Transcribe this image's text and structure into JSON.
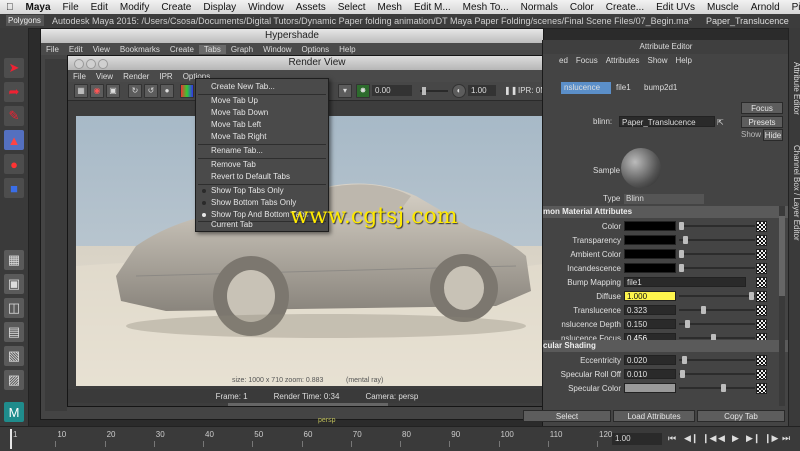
{
  "mac_menubar": {
    "app_name": "Maya",
    "items": [
      "File",
      "Edit",
      "Modify",
      "Create",
      "Display",
      "Window",
      "Assets",
      "Select",
      "Mesh",
      "Edit M...",
      "Mesh To...",
      "Normals",
      "Color",
      "Create...",
      "Edit UVs",
      "Muscle",
      "Arnold",
      "Pipeline"
    ]
  },
  "maya_window": {
    "mode": "Polygons",
    "title": "Autodesk Maya 2015: /Users/Csosa/Documents/Digital Tutors/Dynamic Paper folding animation/DT Maya Paper Folding/scenes/Final Scene Files/07_Begin.ma*",
    "title_suffix": "---",
    "title_right": "Paper_Translucence"
  },
  "hypershade": {
    "title": "Hypershade",
    "menu": [
      "File",
      "Edit",
      "View",
      "Bookmarks",
      "Create",
      "Tabs",
      "Graph",
      "Window",
      "Options",
      "Help"
    ]
  },
  "render_view": {
    "title": "Render View",
    "menu": [
      "File",
      "View",
      "Render",
      "IPR",
      "Options"
    ],
    "exposure": "0.00",
    "gamma": "1.00",
    "ipr_status": "IPR: 0MB",
    "overlay_text": "size: 1000 x 710 zoom: 0.883",
    "overlay_renderer": "(mental ray)",
    "status": {
      "frame": "Frame: 1",
      "render_time": "Render Time: 0:34",
      "camera": "Camera: persp"
    }
  },
  "tab_menu": {
    "items": [
      {
        "label": "Create New Tab..."
      },
      {
        "label": "Move Tab Up"
      },
      {
        "label": "Move Tab Down"
      },
      {
        "label": "Move Tab Left"
      },
      {
        "label": "Move Tab Right"
      },
      {
        "label": "Rename Tab..."
      },
      {
        "label": "Remove Tab"
      },
      {
        "label": "Revert to Default Tabs"
      },
      {
        "label": "Show Top Tabs Only"
      },
      {
        "label": "Show Bottom Tabs Only"
      },
      {
        "label": "Show Top And Bottom Tabs",
        "selected": true
      },
      {
        "label": "Current Tab"
      }
    ]
  },
  "attribute_editor": {
    "title": "Attribute Editor",
    "menu": [
      "ed",
      "Focus",
      "Attributes",
      "Show",
      "Help"
    ],
    "tabs": [
      "nslucence",
      "file1",
      "bump2d1"
    ],
    "type_label": "blinn:",
    "material_name": "Paper_Translucence",
    "focus_btn": "Focus",
    "presets_btn": "Presets",
    "show_btn": "Show",
    "hide_btn": "Hide",
    "sample_label": "Sample",
    "type_row_label": "Type",
    "type_value": "Blinn",
    "section_common": "mon Material Attributes",
    "section_specular": "cular Shading",
    "attrs": [
      {
        "label": "Color",
        "kind": "color",
        "color": "#000000",
        "knob": 0.0
      },
      {
        "label": "Transparency",
        "kind": "color",
        "color": "#000000",
        "knob": 0.05
      },
      {
        "label": "Ambient Color",
        "kind": "color",
        "color": "#000000",
        "knob": 0.0
      },
      {
        "label": "Incandescence",
        "kind": "color",
        "color": "#000000",
        "knob": 0.0
      },
      {
        "label": "Bump Mapping",
        "kind": "map",
        "value": "file1"
      },
      {
        "label": "Diffuse",
        "kind": "num",
        "value": "1.000",
        "highlight": true,
        "knob": 1.0
      },
      {
        "label": "Translucence",
        "kind": "num",
        "value": "0.323",
        "knob": 0.32
      },
      {
        "label": "nslucence Depth",
        "kind": "num",
        "value": "0.150",
        "knob": 0.08
      },
      {
        "label": "nslucence Focus",
        "kind": "num",
        "value": "0.456",
        "selected": true,
        "knob": 0.46
      }
    ],
    "spec_attrs": [
      {
        "label": "Eccentricity",
        "kind": "num",
        "value": "0.020",
        "knob": 0.04
      },
      {
        "label": "Specular Roll Off",
        "kind": "num",
        "value": "0.010",
        "knob": 0.02
      },
      {
        "label": "Specular Color",
        "kind": "color",
        "color": "#9a9a9a",
        "knob": 0.6
      }
    ],
    "bottom_buttons": [
      "Select",
      "Load Attributes",
      "Copy Tab"
    ]
  },
  "side_tabs": [
    "Attribute Editor",
    "Channel Box / Layer Editor"
  ],
  "timeslider": {
    "ticks": [
      "1",
      "10",
      "20",
      "30",
      "40",
      "50",
      "60",
      "70",
      "80",
      "90",
      "100",
      "110",
      "120"
    ],
    "current_frame": "1.00"
  },
  "watermark": "www.cgtsj.com",
  "perspective_label": "persp"
}
